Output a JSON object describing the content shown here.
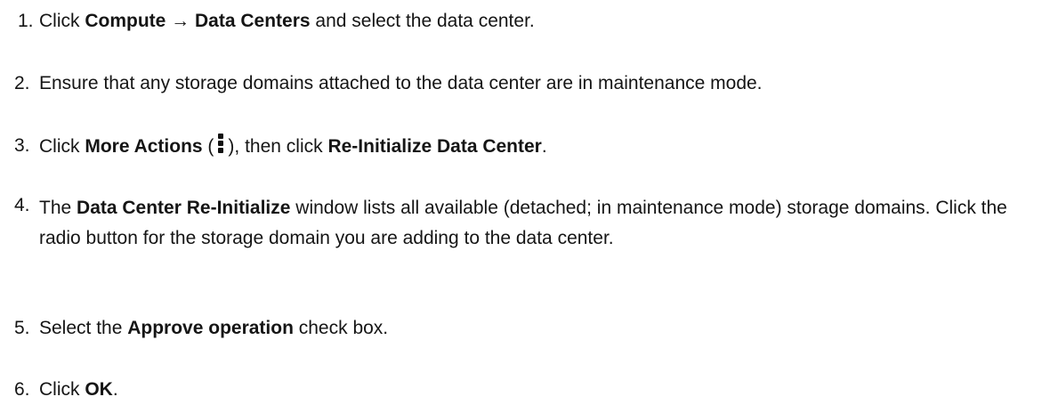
{
  "steps": [
    {
      "num": "1.",
      "parts": [
        "Click ",
        "Compute → Data Centers",
        " and select the data center."
      ]
    },
    {
      "num": "2.",
      "text": "Ensure that any storage domains attached to the data center are in maintenance mode."
    },
    {
      "num": "3.",
      "parts": [
        "Click ",
        "More Actions",
        " (",
        "), then click ",
        "Re-Initialize Data Center",
        "."
      ],
      "icon": "more-actions-kebab-icon"
    },
    {
      "num": "4.",
      "parts": [
        "The ",
        "Data Center Re-Initialize",
        " window lists all available (detached; in maintenance mode) storage domains. Click the radio button for the storage domain you are adding to the data center."
      ]
    },
    {
      "num": "5.",
      "parts": [
        "Select the ",
        "Approve operation",
        " check box."
      ]
    },
    {
      "num": "6.",
      "parts": [
        "Click ",
        "OK",
        "."
      ]
    }
  ]
}
